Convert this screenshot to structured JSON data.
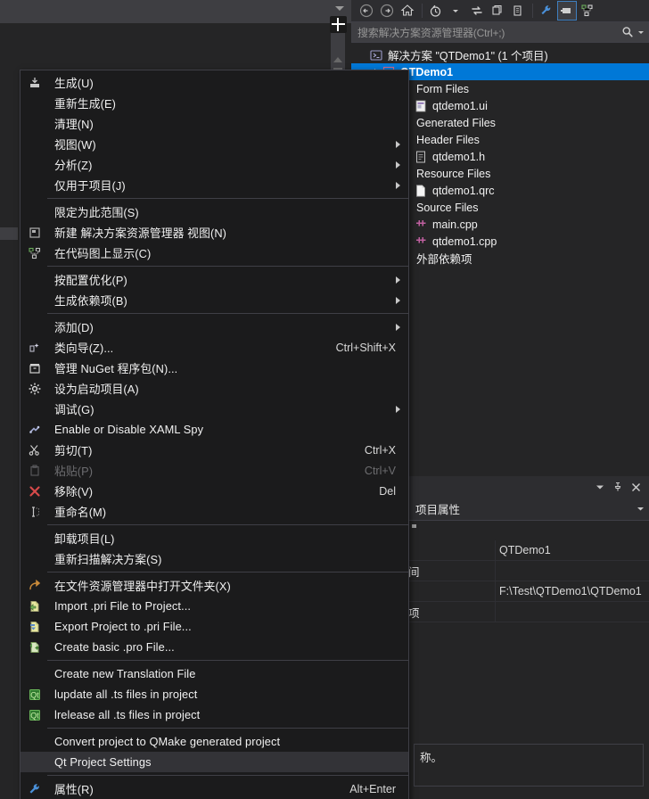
{
  "solution_explorer": {
    "toolbar_buttons": [
      {
        "name": "back-button",
        "icon": "back-arrow-icon"
      },
      {
        "name": "forward-button",
        "icon": "forward-arrow-icon"
      },
      {
        "name": "home-button",
        "icon": "home-icon"
      },
      {
        "name": "pending-changes-button",
        "icon": "clock-icon"
      },
      {
        "name": "sync-with-active-document-button",
        "icon": "sync-arrows-icon"
      },
      {
        "name": "refresh-button",
        "icon": "copy-icon"
      },
      {
        "name": "show-all-files-button",
        "icon": "documents-icon"
      },
      {
        "name": "properties-button",
        "icon": "wrench-icon"
      },
      {
        "name": "preview-selected-items-button",
        "icon": "preview-icon"
      },
      {
        "name": "collapse-all-button",
        "icon": "code-map-icon"
      }
    ],
    "search_placeholder": "搜索解决方案资源管理器(Ctrl+;)",
    "search_value": "",
    "tree": [
      {
        "label": "解决方案 \"QTDemo1\" (1 个项目)",
        "indent": 0,
        "icon": "solution-icon",
        "selected": false,
        "expander": false
      },
      {
        "label": "QTDemo1",
        "indent": 1,
        "icon": "project-icon",
        "selected": true,
        "expander": true
      },
      {
        "label": "Form Files",
        "indent": 2,
        "icon": "none",
        "selected": false,
        "expander": false
      },
      {
        "label": "qtdemo1.ui",
        "indent": 3,
        "icon": "ui-file-icon",
        "selected": false,
        "expander": false
      },
      {
        "label": "Generated Files",
        "indent": 2,
        "icon": "none",
        "selected": false,
        "expander": false
      },
      {
        "label": "Header Files",
        "indent": 2,
        "icon": "none",
        "selected": false,
        "expander": false
      },
      {
        "label": "qtdemo1.h",
        "indent": 3,
        "icon": "header-file-icon",
        "selected": false,
        "expander": false
      },
      {
        "label": "Resource Files",
        "indent": 2,
        "icon": "none",
        "selected": false,
        "expander": false
      },
      {
        "label": "qtdemo1.qrc",
        "indent": 3,
        "icon": "qrc-file-icon",
        "selected": false,
        "expander": false
      },
      {
        "label": "Source Files",
        "indent": 2,
        "icon": "none",
        "selected": false,
        "expander": false
      },
      {
        "label": "main.cpp",
        "indent": 3,
        "icon": "cpp-file-icon",
        "selected": false,
        "expander": false
      },
      {
        "label": "qtdemo1.cpp",
        "indent": 3,
        "icon": "cpp-file-icon",
        "selected": false,
        "expander": false
      },
      {
        "label": "外部依赖项",
        "indent": 2,
        "icon": "none",
        "selected": false,
        "expander": false
      }
    ]
  },
  "properties_panel": {
    "title_controls": [
      {
        "name": "window-menu-button",
        "icon": "chevron-down-icon"
      },
      {
        "name": "pin-button",
        "icon": "pin-icon"
      },
      {
        "name": "close-button",
        "icon": "close-icon"
      }
    ],
    "selector_label": "项目属性",
    "rows": [
      {
        "name": "",
        "value": "QTDemo1"
      },
      {
        "name": "间",
        "value": ""
      },
      {
        "name": "",
        "value": "F:\\Test\\QTDemo1\\QTDemo1"
      },
      {
        "name": "项",
        "value": ""
      }
    ],
    "description": "称。"
  },
  "context_menu": {
    "items": [
      {
        "type": "item",
        "label": "生成(U)",
        "shortcut": "",
        "icon": "build-icon",
        "submenu": false,
        "disabled": false,
        "hover": false
      },
      {
        "type": "item",
        "label": "重新生成(E)",
        "shortcut": "",
        "icon": "none",
        "submenu": false,
        "disabled": false,
        "hover": false
      },
      {
        "type": "item",
        "label": "清理(N)",
        "shortcut": "",
        "icon": "none",
        "submenu": false,
        "disabled": false,
        "hover": false
      },
      {
        "type": "item",
        "label": "视图(W)",
        "shortcut": "",
        "icon": "none",
        "submenu": true,
        "disabled": false,
        "hover": false
      },
      {
        "type": "item",
        "label": "分析(Z)",
        "shortcut": "",
        "icon": "none",
        "submenu": true,
        "disabled": false,
        "hover": false
      },
      {
        "type": "item",
        "label": "仅用于项目(J)",
        "shortcut": "",
        "icon": "none",
        "submenu": true,
        "disabled": false,
        "hover": false
      },
      {
        "type": "separator"
      },
      {
        "type": "item",
        "label": "限定为此范围(S)",
        "shortcut": "",
        "icon": "none",
        "submenu": false,
        "disabled": false,
        "hover": false
      },
      {
        "type": "item",
        "label": "新建 解决方案资源管理器 视图(N)",
        "shortcut": "",
        "icon": "new-view-icon",
        "submenu": false,
        "disabled": false,
        "hover": false
      },
      {
        "type": "item",
        "label": "在代码图上显示(C)",
        "shortcut": "",
        "icon": "code-map-icon",
        "submenu": false,
        "disabled": false,
        "hover": false
      },
      {
        "type": "separator"
      },
      {
        "type": "item",
        "label": "按配置优化(P)",
        "shortcut": "",
        "icon": "none",
        "submenu": true,
        "disabled": false,
        "hover": false
      },
      {
        "type": "item",
        "label": "生成依赖项(B)",
        "shortcut": "",
        "icon": "none",
        "submenu": true,
        "disabled": false,
        "hover": false
      },
      {
        "type": "separator"
      },
      {
        "type": "item",
        "label": "添加(D)",
        "shortcut": "",
        "icon": "none",
        "submenu": true,
        "disabled": false,
        "hover": false
      },
      {
        "type": "item",
        "label": "类向导(Z)...",
        "shortcut": "Ctrl+Shift+X",
        "icon": "class-wizard-icon",
        "submenu": false,
        "disabled": false,
        "hover": false
      },
      {
        "type": "item",
        "label": "管理 NuGet 程序包(N)...",
        "shortcut": "",
        "icon": "nuget-icon",
        "submenu": false,
        "disabled": false,
        "hover": false
      },
      {
        "type": "item",
        "label": "设为启动项目(A)",
        "shortcut": "",
        "icon": "gear-icon",
        "submenu": false,
        "disabled": false,
        "hover": false
      },
      {
        "type": "item",
        "label": "调试(G)",
        "shortcut": "",
        "icon": "none",
        "submenu": true,
        "disabled": false,
        "hover": false
      },
      {
        "type": "item",
        "label": "Enable or Disable XAML Spy",
        "shortcut": "",
        "icon": "xaml-spy-icon",
        "submenu": false,
        "disabled": false,
        "hover": false
      },
      {
        "type": "item",
        "label": "剪切(T)",
        "shortcut": "Ctrl+X",
        "icon": "scissors-icon",
        "submenu": false,
        "disabled": false,
        "hover": false
      },
      {
        "type": "item",
        "label": "粘贴(P)",
        "shortcut": "Ctrl+V",
        "icon": "paste-icon",
        "submenu": false,
        "disabled": true,
        "hover": false
      },
      {
        "type": "item",
        "label": "移除(V)",
        "shortcut": "Del",
        "icon": "remove-x-icon",
        "submenu": false,
        "disabled": false,
        "hover": false
      },
      {
        "type": "item",
        "label": "重命名(M)",
        "shortcut": "",
        "icon": "rename-icon",
        "submenu": false,
        "disabled": false,
        "hover": false
      },
      {
        "type": "separator"
      },
      {
        "type": "item",
        "label": "卸载项目(L)",
        "shortcut": "",
        "icon": "none",
        "submenu": false,
        "disabled": false,
        "hover": false
      },
      {
        "type": "item",
        "label": "重新扫描解决方案(S)",
        "shortcut": "",
        "icon": "none",
        "submenu": false,
        "disabled": false,
        "hover": false
      },
      {
        "type": "separator"
      },
      {
        "type": "item",
        "label": "在文件资源管理器中打开文件夹(X)",
        "shortcut": "",
        "icon": "open-folder-icon",
        "submenu": false,
        "disabled": false,
        "hover": false
      },
      {
        "type": "item",
        "label": "Import .pri File to Project...",
        "shortcut": "",
        "icon": "qt-import-icon",
        "submenu": false,
        "disabled": false,
        "hover": false
      },
      {
        "type": "item",
        "label": "Export Project to .pri File...",
        "shortcut": "",
        "icon": "qt-export-icon",
        "submenu": false,
        "disabled": false,
        "hover": false
      },
      {
        "type": "item",
        "label": "Create basic .pro File...",
        "shortcut": "",
        "icon": "qt-create-icon",
        "submenu": false,
        "disabled": false,
        "hover": false
      },
      {
        "type": "separator"
      },
      {
        "type": "item",
        "label": "Create new Translation File",
        "shortcut": "",
        "icon": "none",
        "submenu": false,
        "disabled": false,
        "hover": false
      },
      {
        "type": "item",
        "label": "lupdate all .ts files in project",
        "shortcut": "",
        "icon": "qt-logo-icon",
        "submenu": false,
        "disabled": false,
        "hover": false
      },
      {
        "type": "item",
        "label": "lrelease all .ts files in project",
        "shortcut": "",
        "icon": "qt-logo-icon",
        "submenu": false,
        "disabled": false,
        "hover": false
      },
      {
        "type": "separator"
      },
      {
        "type": "item",
        "label": "Convert project to QMake generated project",
        "shortcut": "",
        "icon": "none",
        "submenu": false,
        "disabled": false,
        "hover": false
      },
      {
        "type": "item",
        "label": "Qt Project Settings",
        "shortcut": "",
        "icon": "none",
        "submenu": false,
        "disabled": false,
        "hover": true
      },
      {
        "type": "separator"
      },
      {
        "type": "item",
        "label": "属性(R)",
        "shortcut": "Alt+Enter",
        "icon": "wrench-icon",
        "submenu": false,
        "disabled": false,
        "hover": false
      }
    ]
  },
  "colors": {
    "menu_bg": "#1b1b1c",
    "panel_bg": "#252526",
    "chrome_bg": "#2d2d30",
    "selection_blue": "#0078d7",
    "hover_gray": "#333337",
    "text": "#f1f1f1",
    "disabled_text": "#6d6d70"
  }
}
